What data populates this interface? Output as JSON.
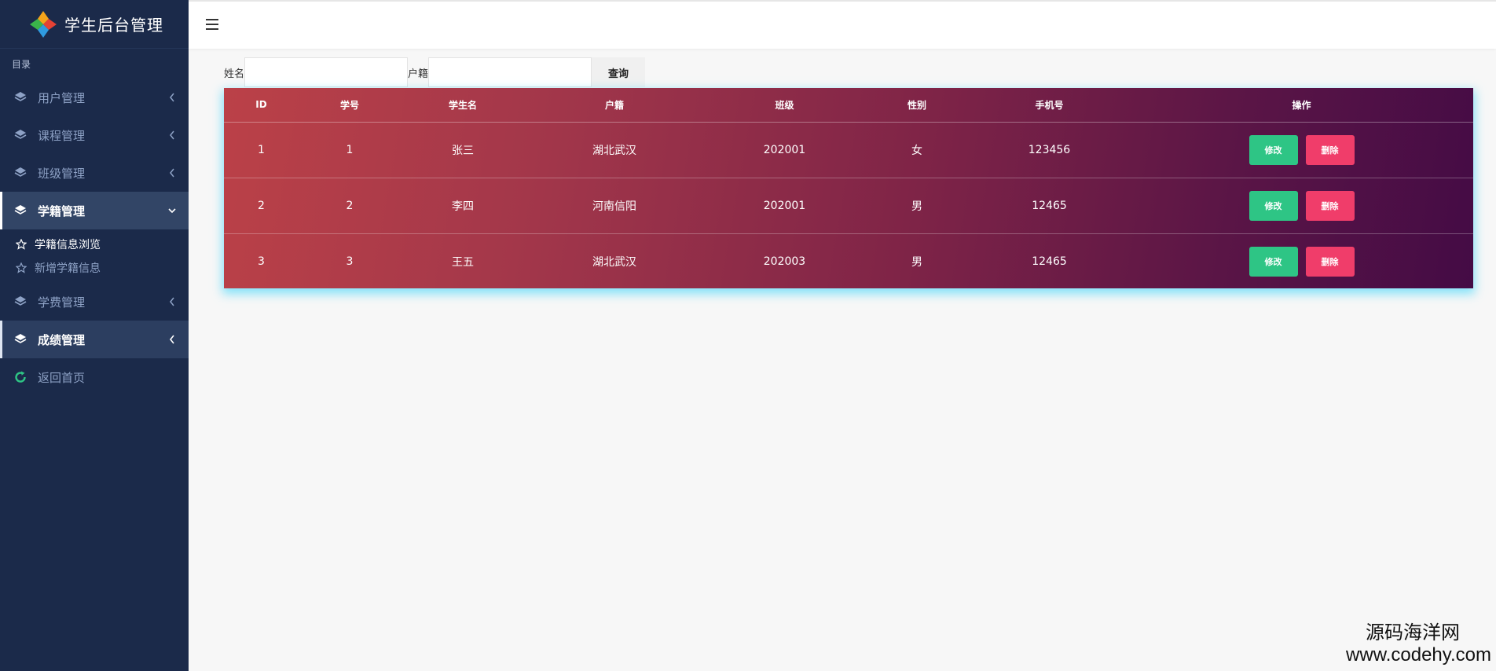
{
  "brand": {
    "title": "学生后台管理"
  },
  "sidebar": {
    "section_label": "目录",
    "items": [
      {
        "label": "用户管理"
      },
      {
        "label": "课程管理"
      },
      {
        "label": "班级管理"
      },
      {
        "label": "学籍管理"
      },
      {
        "label": "学费管理"
      },
      {
        "label": "成绩管理"
      }
    ],
    "submenu": [
      {
        "label": "学籍信息浏览"
      },
      {
        "label": "新增学籍信息"
      }
    ],
    "home_label": "返回首页"
  },
  "search": {
    "name_label": "姓名",
    "name_value": "",
    "hukou_label": "户籍",
    "hukou_value": "",
    "query_label": "查询"
  },
  "table": {
    "columns": [
      "ID",
      "学号",
      "学生名",
      "户籍",
      "班级",
      "性别",
      "手机号",
      "操作"
    ],
    "rows": [
      {
        "id": "1",
        "student_no": "1",
        "name": "张三",
        "hukou": "湖北武汉",
        "class": "202001",
        "gender": "女",
        "phone": "123456"
      },
      {
        "id": "2",
        "student_no": "2",
        "name": "李四",
        "hukou": "河南信阳",
        "class": "202001",
        "gender": "男",
        "phone": "12465"
      },
      {
        "id": "3",
        "student_no": "3",
        "name": "王五",
        "hukou": "湖北武汉",
        "class": "202003",
        "gender": "男",
        "phone": "12465"
      }
    ],
    "edit_label": "修改",
    "delete_label": "删除"
  },
  "watermark": {
    "cn": "源码海洋网",
    "url": "www.codehy.com"
  },
  "colors": {
    "sidebar": "#1b2a4a",
    "edit": "#2ec585",
    "delete": "#f03d6a",
    "table_start": "#bb4148",
    "table_end": "#440b45"
  }
}
